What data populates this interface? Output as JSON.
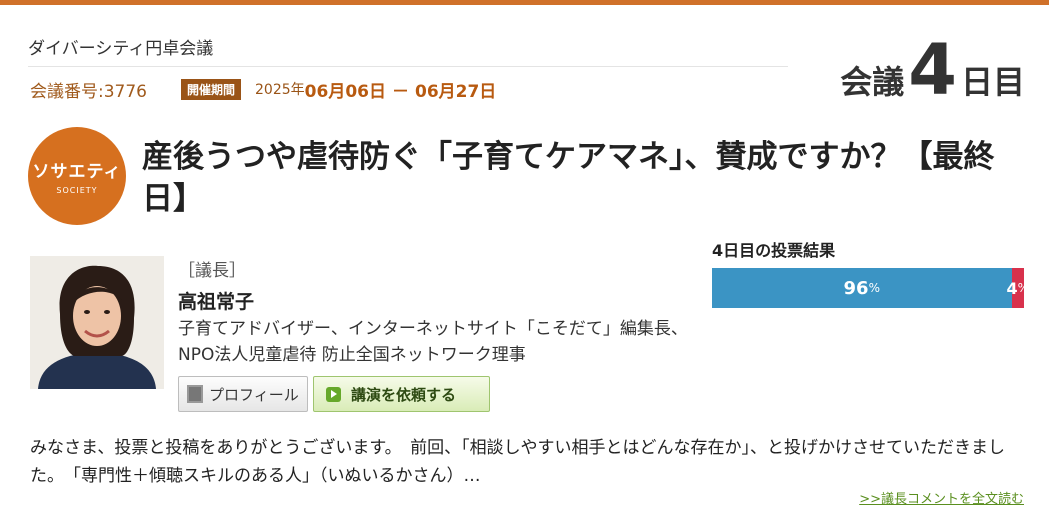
{
  "header": {
    "series": "ダイバーシティ円卓会議",
    "meeting_no": "会議番号:3776",
    "period_label": "開催期間",
    "period_year": "2025年",
    "period_start": "06月06日",
    "period_dash": "－",
    "period_end": "06月27日",
    "day_prefix": "会議",
    "day_number": "4",
    "day_suffix": "日目"
  },
  "category": {
    "name": "ソサエティ",
    "name_en": "SOCIETY",
    "color": "#d6701f"
  },
  "title": "産後うつや虐待防ぐ「子育てケアマネ」、賛成ですか？【最終日】",
  "chair": {
    "label": "［議長］",
    "name": "高祖常子",
    "description": "子育てアドバイザー、インターネットサイト「こそだて」編集長、NPO法人児童虐待 防止全国ネットワーク理事",
    "profile_button": "プロフィール",
    "lecture_button": "講演を依頼する"
  },
  "vote": {
    "heading": "4日目の投票結果",
    "yes_value": "96",
    "no_value": "4",
    "percent_sign": "%",
    "yes_fraction": 0.96,
    "yes_color": "#3b94c4",
    "no_color": "#d8314c"
  },
  "comment": {
    "text": "みなさま、投票と投稿をありがとうございます。　前回、「相談しやすい相手とはどんな存在か」、と投げかけさせていただきました。　「専門性＋傾聴スキルのある人」（いぬいるかさん）…",
    "more_link": ">>議長コメントを全文読む"
  }
}
